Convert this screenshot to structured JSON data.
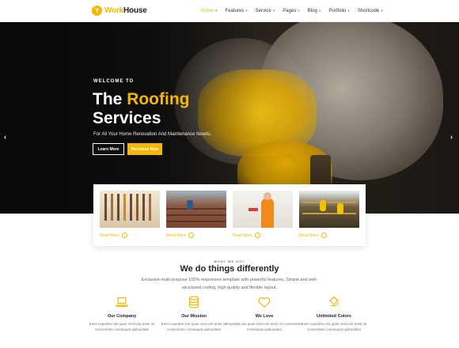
{
  "nav": {
    "logo_work": "Work",
    "logo_house": "House",
    "logo_mark": "Y",
    "items": [
      {
        "label": "Home",
        "active": true
      },
      {
        "label": "Features",
        "active": false
      },
      {
        "label": "Service",
        "active": false
      },
      {
        "label": "Pages",
        "active": false
      },
      {
        "label": "Blog",
        "active": false
      },
      {
        "label": "Portfolio",
        "active": false
      },
      {
        "label": "Shortcode",
        "active": false
      }
    ]
  },
  "hero": {
    "welcome": "WELCOME TO",
    "headline_the": "The",
    "headline_highlight": "Roofing",
    "headline_line2": "Services",
    "subtitle": "For All Your Home Renovation And Maintenance Needs.",
    "learn_more": "Learn More",
    "purchase_now": "Purchase Now",
    "prev_arrow": "‹",
    "next_arrow": "›"
  },
  "cards": [
    {
      "image": "tools-on-wall",
      "more": "Read More"
    },
    {
      "image": "roof-worker",
      "more": "Read More"
    },
    {
      "image": "painter-woman",
      "more": "Read More"
    },
    {
      "image": "construction-workers",
      "more": "Read More"
    }
  ],
  "section": {
    "eyebrow": "WHAT WE DO?",
    "title": "We do things differently",
    "description": "Exclusive multi-purpose 100% responsive template with powerful features, Simple and well-structured coding, high quality and flexible layout."
  },
  "features": [
    {
      "icon": "laptop-icon",
      "title": "Our Company",
      "text": "Enim expedita nisi quae nescuint dolor sit consectetur consequat quibusdam"
    },
    {
      "icon": "stack-icon",
      "title": "Our Mission",
      "text": "Enim expedita nisi quae nescuint dolor sit consectetur consequat quibusdam"
    },
    {
      "icon": "heart-icon",
      "title": "We Love",
      "text": "Expedita nisi quae nescuint dolor sit consectetur consequat quibusdam"
    },
    {
      "icon": "paint-bucket-icon",
      "title": "Unlimited Colors",
      "text": "Enim expedita nisi quae nescuint dolor sit consectetur consequat quibusdam"
    }
  ],
  "colors": {
    "accent": "#f5b800",
    "dark": "#1b1815"
  }
}
